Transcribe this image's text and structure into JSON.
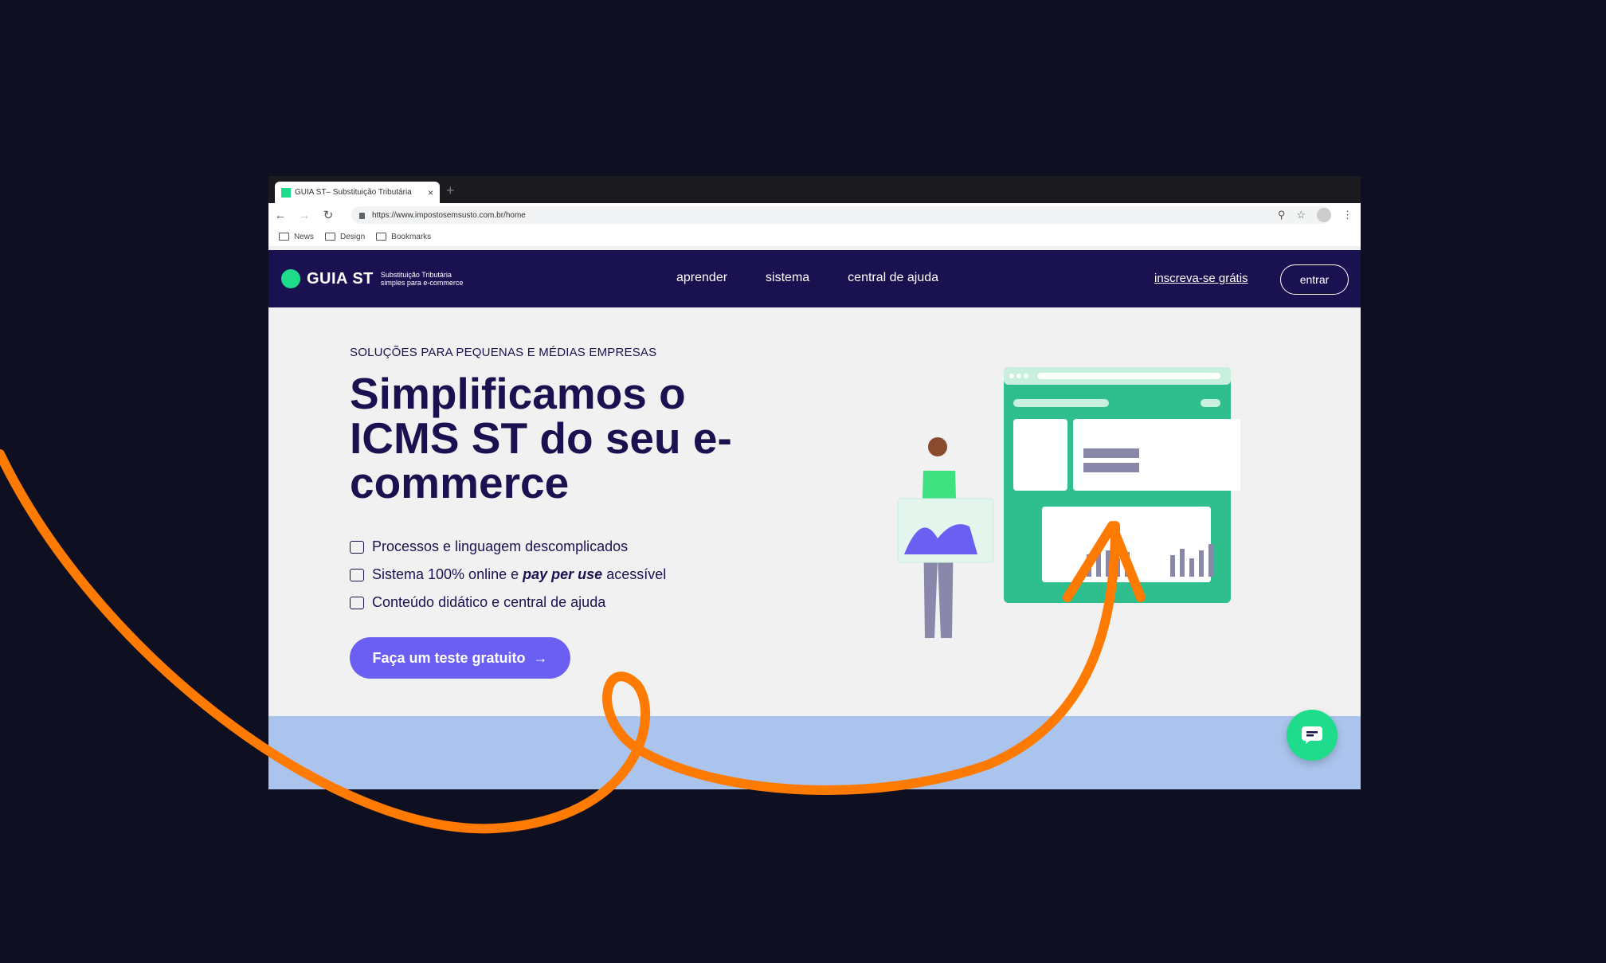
{
  "browser": {
    "tab_title": "GUIA ST– Substituição Tributária",
    "url": "https://www.impostosemsusto.com.br/home",
    "bookmarks": [
      "News",
      "Design",
      "Bookmarks"
    ]
  },
  "header": {
    "logo_name": "GUIA ST",
    "logo_tagline_1": "Substituição Tributária",
    "logo_tagline_2": "simples para e-commerce",
    "nav": [
      "aprender",
      "sistema",
      "central de ajuda"
    ],
    "signup": "inscreva-se grátis",
    "login": "entrar"
  },
  "hero": {
    "eyebrow": "SOLUÇÕES PARA PEQUENAS E MÉDIAS EMPRESAS",
    "headline": "Simplificamos o ICMS ST do seu e-commerce",
    "features": [
      {
        "text": "Processos e linguagem descomplicados",
        "icon": "list-icon"
      },
      {
        "text_before": "Sistema 100% online e ",
        "emphasis": "pay per use",
        "text_after": " acessível",
        "icon": "cart-icon"
      },
      {
        "text": "Conteúdo didático e central de ajuda",
        "icon": "chat-icon"
      }
    ],
    "cta": "Faça um teste gratuito",
    "cta_arrow": "→"
  },
  "colors": {
    "navy": "#1a1250",
    "green": "#1fdc8c",
    "purple": "#6a5ff2",
    "orange": "#ff7a00",
    "band": "#aac4ee",
    "dashboard": "#2fbf8f"
  }
}
